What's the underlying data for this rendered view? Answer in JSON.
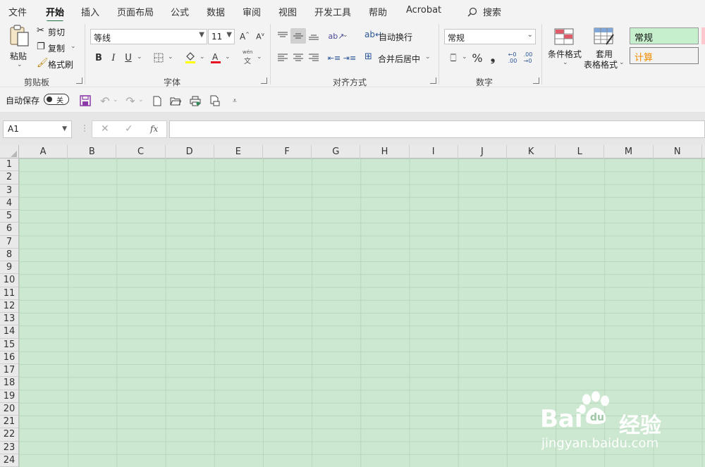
{
  "menu": {
    "tabs": [
      "文件",
      "开始",
      "插入",
      "页面布局",
      "公式",
      "数据",
      "审阅",
      "视图",
      "开发工具",
      "帮助",
      "Acrobat"
    ],
    "search_label": "搜索"
  },
  "clipboard": {
    "paste": "粘贴",
    "cut": "剪切",
    "copy": "复制",
    "format_painter": "格式刷",
    "group_label": "剪贴板"
  },
  "font": {
    "name": "等线",
    "size": "11",
    "bold": "B",
    "italic": "I",
    "underline": "U",
    "phonetic_top": "wén",
    "phonetic_bottom": "文",
    "group_label": "字体",
    "font_color": "#e81123",
    "fill_color": "#ffff00"
  },
  "alignment": {
    "wrap_text": "自动换行",
    "merge_center": "合并后居中",
    "group_label": "对齐方式"
  },
  "number": {
    "format": "常规",
    "percent": "%",
    "comma": "❟",
    "group_label": "数字"
  },
  "styles": {
    "conditional_format": "条件格式",
    "table_format_line1": "套用",
    "table_format_line2": "表格格式",
    "normal_style": "常规",
    "calc_style": "计算"
  },
  "qat": {
    "autosave_label": "自动保存",
    "autosave_state": "关"
  },
  "formula_bar": {
    "name_box": "A1",
    "fx": "fx",
    "value": ""
  },
  "sheet": {
    "columns": [
      "A",
      "B",
      "C",
      "D",
      "E",
      "F",
      "G",
      "H",
      "I",
      "J",
      "K",
      "L",
      "M",
      "N"
    ],
    "rows": [
      "1",
      "2",
      "3",
      "4",
      "5",
      "6",
      "7",
      "8",
      "9",
      "10",
      "11",
      "12",
      "13",
      "14",
      "15",
      "16",
      "17",
      "18",
      "19",
      "20",
      "21",
      "22",
      "23",
      "24"
    ],
    "cell_bg": "#cde8d1",
    "accent": "#217346"
  },
  "watermark": {
    "logo_text_1": "Bai",
    "logo_text_2": "du",
    "logo_cn": "经验",
    "url": "jingyan.baidu.com"
  }
}
